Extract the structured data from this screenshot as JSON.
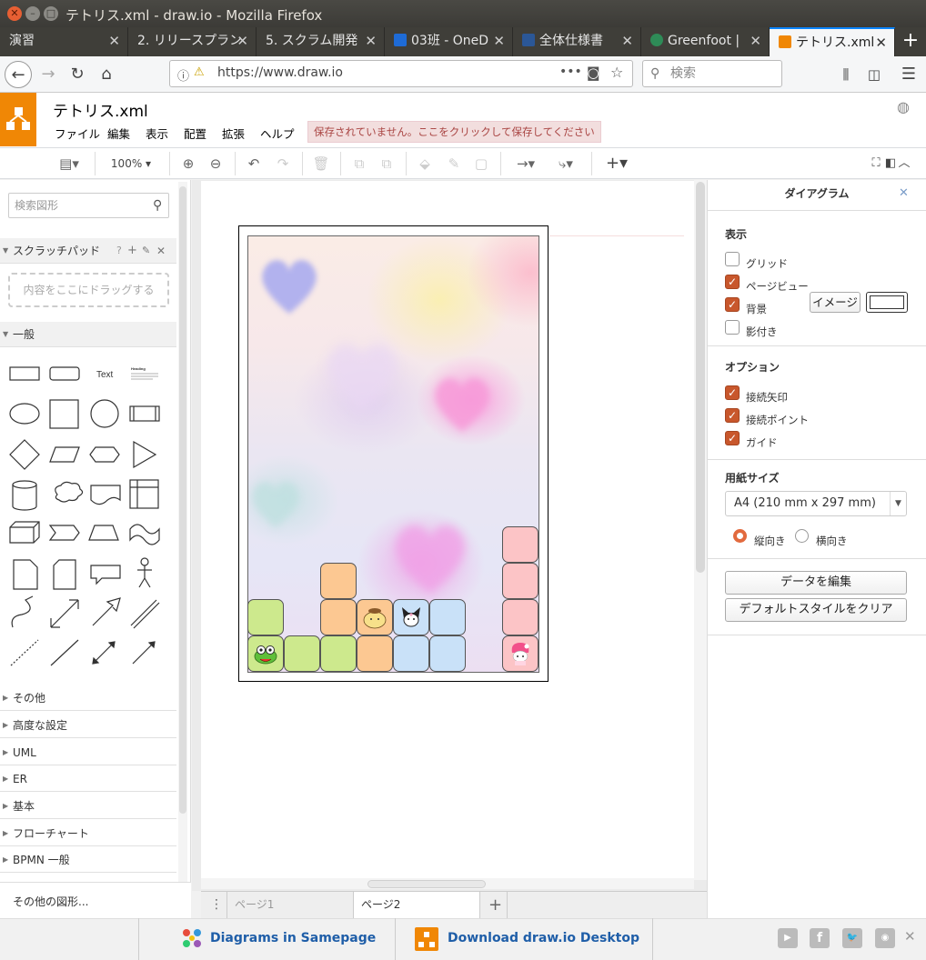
{
  "window": {
    "title": "テトリス.xml - draw.io - Mozilla Firefox"
  },
  "tabs": [
    {
      "label": "演習",
      "color": ""
    },
    {
      "label": "2. リリースプラン",
      "color": ""
    },
    {
      "label": "5. スクラム開発",
      "color": ""
    },
    {
      "label": "03班 - OneD",
      "color": "#1e6bd6"
    },
    {
      "label": "全体仕様書",
      "color": "#2b5797"
    },
    {
      "label": "Greenfoot |",
      "color": "#2e8b57"
    },
    {
      "label": "テトリス.xml",
      "color": "#f08705"
    }
  ],
  "nav": {
    "url": "https://www.draw.io",
    "search_placeholder": "検索"
  },
  "app": {
    "file_title": "テトリス.xml",
    "menu": [
      "ファイル",
      "編集",
      "表示",
      "配置",
      "拡張",
      "ヘルプ"
    ],
    "save_warning": "保存されていません。ここをクリックして保存してください",
    "zoom": "100%"
  },
  "left": {
    "search_placeholder": "検索図形",
    "scratchpad": "スクラッチパッド",
    "scratch_drop": "内容をここにドラッグする",
    "general": "一般",
    "text_shape": "Text",
    "heading_shape": "Heading",
    "sections": [
      "その他",
      "高度な設定",
      "UML",
      "ER",
      "基本",
      "フローチャート",
      "BPMN 一般"
    ],
    "more_shapes": "その他の図形..."
  },
  "pages": {
    "menu_icon": "⋮",
    "tabs": [
      "ページ1",
      "ページ2"
    ],
    "add": "+"
  },
  "right": {
    "title": "ダイアグラム",
    "view_title": "表示",
    "grid": "グリッド",
    "pageview": "ページビュー",
    "background": "背景",
    "shadow": "影付き",
    "image_button": "イメージ",
    "options_title": "オプション",
    "connection_arrows": "接続矢印",
    "connection_points": "接続ポイント",
    "guides": "ガイド",
    "paper_title": "用紙サイズ",
    "paper_size": "A4 (210 mm x 297 mm)",
    "portrait": "縦向き",
    "landscape": "横向き",
    "edit_data": "データを編集",
    "clear_style": "デフォルトスタイルをクリア"
  },
  "footer": {
    "samepage": "Diagrams in Samepage",
    "desktop": "Download draw.io Desktop"
  },
  "colors": {
    "accent": "#f08705",
    "green_block": "#cde98d",
    "orange_block": "#fcc892",
    "blue_block": "#c9e1f8",
    "pink_block": "#fcc4c6",
    "checkbox_on": "#c8572c"
  }
}
